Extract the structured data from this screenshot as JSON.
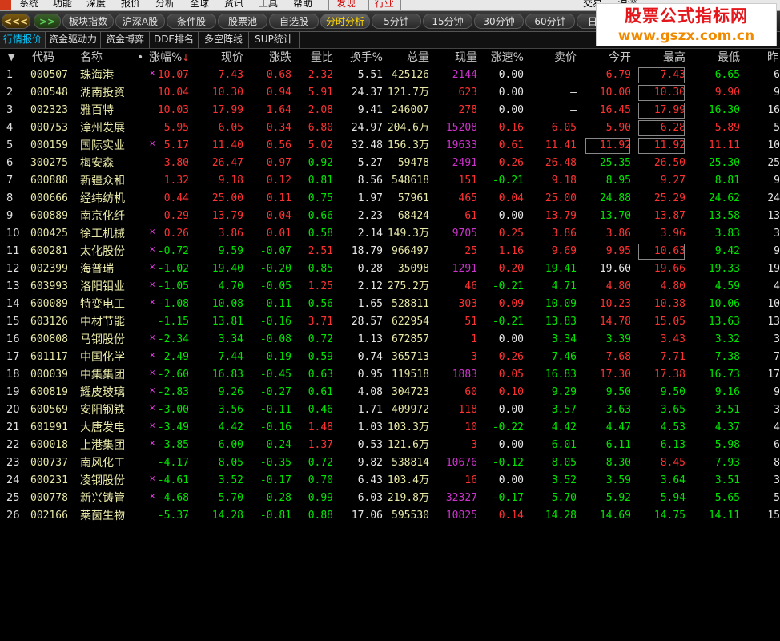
{
  "menu": {
    "items": [
      "系统",
      "功能",
      "深度",
      "报价",
      "分析",
      "全球",
      "资讯",
      "工具",
      "帮助",
      "发现",
      "行业"
    ],
    "partial_right": "交易 … 沪深 … "
  },
  "toolbar": {
    "left_arrow": "<<<",
    "right_arrow": ">>",
    "buttons": [
      "板块指数",
      "沪深A股",
      "条件股",
      "股票池",
      "自选股",
      "分时分析",
      "5分钟",
      "15分钟",
      "30分钟",
      "60分钟",
      "日"
    ],
    "active": "分时分析"
  },
  "tabs": {
    "items": [
      "行情报价",
      "资金驱动力",
      "资金博弈",
      "DDE排名",
      "多空阵线",
      "SUP统计"
    ],
    "active": "行情报价"
  },
  "watermark": {
    "line1": "股票公式指标网",
    "line2": "www.gszx.com.cn"
  },
  "table": {
    "sort_icon": "▼",
    "headers": {
      "code": "代码",
      "name": "名称",
      "dot": "•",
      "change_pct": "涨幅%",
      "price": "现价",
      "change": "涨跌",
      "vol_ratio": "量比",
      "turnover": "换手%",
      "total_vol": "总量",
      "cur_vol": "现量",
      "speed": "涨速%",
      "ask": "卖价",
      "open": "今开",
      "high": "最高",
      "low": "最低",
      "prev": "昨"
    },
    "sort_arrow": "↓",
    "rows": [
      {
        "idx": "1",
        "code": "000507",
        "name": "珠海港",
        "mark": "×",
        "pct": "10.07",
        "price": "7.43",
        "chg": "0.68",
        "vr": "2.32",
        "to": "5.51",
        "tv": "425126",
        "cv": "2144",
        "sp": "0.00",
        "ask": "—",
        "open": "6.79",
        "high": "7.43",
        "low": "6.65",
        "prev": "6"
      },
      {
        "idx": "2",
        "code": "000548",
        "name": "湖南投资",
        "mark": "",
        "pct": "10.04",
        "price": "10.30",
        "chg": "0.94",
        "vr": "5.91",
        "to": "24.37",
        "tv": "121.7万",
        "cv": "623",
        "sp": "0.00",
        "ask": "—",
        "open": "10.00",
        "high": "10.30",
        "low": "9.90",
        "prev": "9"
      },
      {
        "idx": "3",
        "code": "002323",
        "name": "雅百特",
        "mark": "",
        "pct": "10.03",
        "price": "17.99",
        "chg": "1.64",
        "vr": "2.08",
        "to": "9.41",
        "tv": "246007",
        "cv": "278",
        "sp": "0.00",
        "ask": "—",
        "open": "16.45",
        "high": "17.99",
        "low": "16.30",
        "prev": "16"
      },
      {
        "idx": "4",
        "code": "000753",
        "name": "漳州发展",
        "mark": "",
        "pct": "5.95",
        "price": "6.05",
        "chg": "0.34",
        "vr": "6.80",
        "to": "24.97",
        "tv": "204.6万",
        "cv": "15208",
        "sp": "0.16",
        "ask": "6.05",
        "open": "5.90",
        "high": "6.28",
        "low": "5.89",
        "prev": "5"
      },
      {
        "idx": "5",
        "code": "000159",
        "name": "国际实业",
        "mark": "×",
        "pct": "5.17",
        "price": "11.40",
        "chg": "0.56",
        "vr": "5.02",
        "to": "32.48",
        "tv": "156.3万",
        "cv": "19633",
        "sp": "0.61",
        "ask": "11.41",
        "open": "11.92",
        "high": "11.92",
        "low": "11.11",
        "prev": "10"
      },
      {
        "idx": "6",
        "code": "300275",
        "name": "梅安森",
        "mark": "",
        "pct": "3.80",
        "price": "26.47",
        "chg": "0.97",
        "vr": "0.92",
        "to": "5.27",
        "tv": "59478",
        "cv": "2491",
        "sp": "0.26",
        "ask": "26.48",
        "open": "25.35",
        "high": "26.50",
        "low": "25.30",
        "prev": "25"
      },
      {
        "idx": "7",
        "code": "600888",
        "name": "新疆众和",
        "mark": "",
        "pct": "1.32",
        "price": "9.18",
        "chg": "0.12",
        "vr": "0.81",
        "to": "8.56",
        "tv": "548618",
        "cv": "151",
        "sp": "-0.21",
        "ask": "9.18",
        "open": "8.95",
        "high": "9.27",
        "low": "8.81",
        "prev": "9"
      },
      {
        "idx": "8",
        "code": "000666",
        "name": "经纬纺机",
        "mark": "",
        "pct": "0.44",
        "price": "25.00",
        "chg": "0.11",
        "vr": "0.75",
        "to": "1.97",
        "tv": "57961",
        "cv": "465",
        "sp": "0.04",
        "ask": "25.00",
        "open": "24.88",
        "high": "25.29",
        "low": "24.62",
        "prev": "24"
      },
      {
        "idx": "9",
        "code": "600889",
        "name": "南京化纤",
        "mark": "",
        "pct": "0.29",
        "price": "13.79",
        "chg": "0.04",
        "vr": "0.66",
        "to": "2.23",
        "tv": "68424",
        "cv": "61",
        "sp": "0.00",
        "ask": "13.79",
        "open": "13.70",
        "high": "13.87",
        "low": "13.58",
        "prev": "13"
      },
      {
        "idx": "10",
        "code": "000425",
        "name": "徐工机械",
        "mark": "×",
        "pct": "0.26",
        "price": "3.86",
        "chg": "0.01",
        "vr": "0.58",
        "to": "2.14",
        "tv": "149.3万",
        "cv": "9705",
        "sp": "0.25",
        "ask": "3.86",
        "open": "3.86",
        "high": "3.96",
        "low": "3.83",
        "prev": "3"
      },
      {
        "idx": "11",
        "code": "600281",
        "name": "太化股份",
        "mark": "×",
        "pct": "-0.72",
        "price": "9.59",
        "chg": "-0.07",
        "vr": "2.51",
        "to": "18.79",
        "tv": "966497",
        "cv": "25",
        "sp": "1.16",
        "ask": "9.69",
        "open": "9.95",
        "high": "10.63",
        "low": "9.42",
        "prev": "9"
      },
      {
        "idx": "12",
        "code": "002399",
        "name": "海普瑞",
        "mark": "×",
        "pct": "-1.02",
        "price": "19.40",
        "chg": "-0.20",
        "vr": "0.85",
        "to": "0.28",
        "tv": "35098",
        "cv": "1291",
        "sp": "0.20",
        "ask": "19.41",
        "open": "19.60",
        "high": "19.66",
        "low": "19.33",
        "prev": "19"
      },
      {
        "idx": "13",
        "code": "603993",
        "name": "洛阳钼业",
        "mark": "×",
        "pct": "-1.05",
        "price": "4.70",
        "chg": "-0.05",
        "vr": "1.25",
        "to": "2.12",
        "tv": "275.2万",
        "cv": "46",
        "sp": "-0.21",
        "ask": "4.71",
        "open": "4.80",
        "high": "4.80",
        "low": "4.59",
        "prev": "4"
      },
      {
        "idx": "14",
        "code": "600089",
        "name": "特变电工",
        "mark": "×",
        "pct": "-1.08",
        "price": "10.08",
        "chg": "-0.11",
        "vr": "0.56",
        "to": "1.65",
        "tv": "528811",
        "cv": "303",
        "sp": "0.09",
        "ask": "10.09",
        "open": "10.23",
        "high": "10.38",
        "low": "10.06",
        "prev": "10"
      },
      {
        "idx": "15",
        "code": "603126",
        "name": "中材节能",
        "mark": "",
        "pct": "-1.15",
        "price": "13.81",
        "chg": "-0.16",
        "vr": "3.71",
        "to": "28.57",
        "tv": "622954",
        "cv": "51",
        "sp": "-0.21",
        "ask": "13.83",
        "open": "14.78",
        "high": "15.05",
        "low": "13.63",
        "prev": "13"
      },
      {
        "idx": "16",
        "code": "600808",
        "name": "马钢股份",
        "mark": "×",
        "pct": "-2.34",
        "price": "3.34",
        "chg": "-0.08",
        "vr": "0.72",
        "to": "1.13",
        "tv": "672857",
        "cv": "1",
        "sp": "0.00",
        "ask": "3.34",
        "open": "3.39",
        "high": "3.43",
        "low": "3.32",
        "prev": "3"
      },
      {
        "idx": "17",
        "code": "601117",
        "name": "中国化学",
        "mark": "×",
        "pct": "-2.49",
        "price": "7.44",
        "chg": "-0.19",
        "vr": "0.59",
        "to": "0.74",
        "tv": "365713",
        "cv": "3",
        "sp": "0.26",
        "ask": "7.46",
        "open": "7.68",
        "high": "7.71",
        "low": "7.38",
        "prev": "7"
      },
      {
        "idx": "18",
        "code": "000039",
        "name": "中集集团",
        "mark": "×",
        "pct": "-2.60",
        "price": "16.83",
        "chg": "-0.45",
        "vr": "0.63",
        "to": "0.95",
        "tv": "119518",
        "cv": "1883",
        "sp": "0.05",
        "ask": "16.83",
        "open": "17.30",
        "high": "17.38",
        "low": "16.73",
        "prev": "17"
      },
      {
        "idx": "19",
        "code": "600819",
        "name": "耀皮玻璃",
        "mark": "×",
        "pct": "-2.83",
        "price": "9.26",
        "chg": "-0.27",
        "vr": "0.61",
        "to": "4.08",
        "tv": "304723",
        "cv": "60",
        "sp": "0.10",
        "ask": "9.29",
        "open": "9.50",
        "high": "9.50",
        "low": "9.16",
        "prev": "9"
      },
      {
        "idx": "20",
        "code": "600569",
        "name": "安阳钢铁",
        "mark": "×",
        "pct": "-3.00",
        "price": "3.56",
        "chg": "-0.11",
        "vr": "0.46",
        "to": "1.71",
        "tv": "409972",
        "cv": "118",
        "sp": "0.00",
        "ask": "3.57",
        "open": "3.63",
        "high": "3.65",
        "low": "3.51",
        "prev": "3"
      },
      {
        "idx": "21",
        "code": "601991",
        "name": "大唐发电",
        "mark": "×",
        "pct": "-3.49",
        "price": "4.42",
        "chg": "-0.16",
        "vr": "1.48",
        "to": "1.03",
        "tv": "103.3万",
        "cv": "10",
        "sp": "-0.22",
        "ask": "4.42",
        "open": "4.47",
        "high": "4.53",
        "low": "4.37",
        "prev": "4"
      },
      {
        "idx": "22",
        "code": "600018",
        "name": "上港集团",
        "mark": "×",
        "pct": "-3.85",
        "price": "6.00",
        "chg": "-0.24",
        "vr": "1.37",
        "to": "0.53",
        "tv": "121.6万",
        "cv": "3",
        "sp": "0.00",
        "ask": "6.01",
        "open": "6.11",
        "high": "6.13",
        "low": "5.98",
        "prev": "6"
      },
      {
        "idx": "23",
        "code": "000737",
        "name": "南风化工",
        "mark": "",
        "pct": "-4.17",
        "price": "8.05",
        "chg": "-0.35",
        "vr": "0.72",
        "to": "9.82",
        "tv": "538814",
        "cv": "10676",
        "sp": "-0.12",
        "ask": "8.05",
        "open": "8.30",
        "high": "8.45",
        "low": "7.93",
        "prev": "8"
      },
      {
        "idx": "24",
        "code": "600231",
        "name": "凌钢股份",
        "mark": "×",
        "pct": "-4.61",
        "price": "3.52",
        "chg": "-0.17",
        "vr": "0.70",
        "to": "6.43",
        "tv": "103.4万",
        "cv": "16",
        "sp": "0.00",
        "ask": "3.52",
        "open": "3.59",
        "high": "3.64",
        "low": "3.51",
        "prev": "3"
      },
      {
        "idx": "25",
        "code": "000778",
        "name": "新兴铸管",
        "mark": "×",
        "pct": "-4.68",
        "price": "5.70",
        "chg": "-0.28",
        "vr": "0.99",
        "to": "6.03",
        "tv": "219.8万",
        "cv": "32327",
        "sp": "-0.17",
        "ask": "5.70",
        "open": "5.92",
        "high": "5.94",
        "low": "5.65",
        "prev": "5"
      },
      {
        "idx": "26",
        "code": "002166",
        "name": "莱茵生物",
        "mark": "",
        "pct": "-5.37",
        "price": "14.28",
        "chg": "-0.81",
        "vr": "0.88",
        "to": "17.06",
        "tv": "595530",
        "cv": "10825",
        "sp": "0.14",
        "ask": "14.28",
        "open": "14.69",
        "high": "14.75",
        "low": "14.11",
        "prev": "15"
      }
    ]
  },
  "colors": {
    "up": "#ff3232",
    "down": "#00e600",
    "flat": "#e6e6e6",
    "name": "#e8e8a8",
    "vol_up": "#cc33cc"
  }
}
